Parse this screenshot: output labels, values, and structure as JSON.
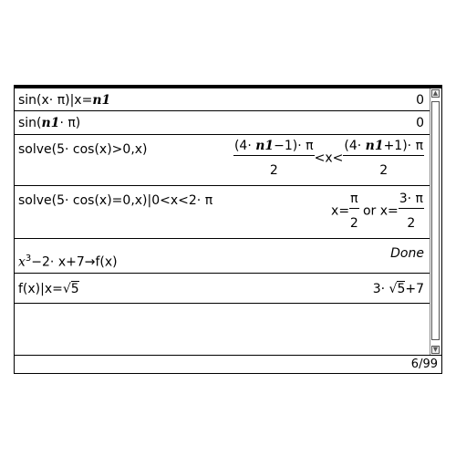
{
  "rows": [
    {
      "input_prefix": "sin(x· π)|x=",
      "input_bold": "n1",
      "output": "0"
    },
    {
      "input_prefix": "sin(",
      "input_bold": "n1",
      "input_suffix": "· π)",
      "output": "0"
    },
    {
      "input": "solve(5· cos(x)>0,x)",
      "output": {
        "left_num_pre": "(4· ",
        "left_num_bold": "n1",
        "left_num_post": "−1)· π",
        "left_den": "2",
        "middle": "<x<",
        "right_num_pre": "(4· ",
        "right_num_bold": "n1",
        "right_num_post": "+1)· π",
        "right_den": "2"
      }
    },
    {
      "input": "solve(5· cos(x)=0,x)|0<x<2· π",
      "output": {
        "lhs1": "x=",
        "frac1_num": "π",
        "frac1_den": "2",
        "or": "or",
        "lhs2": "x=",
        "frac2_num": "3· π",
        "frac2_den": "2"
      }
    },
    {
      "input_pre": "x",
      "input_exp": "3",
      "input_post": "−2· x+7→f(x)",
      "output": "Done"
    },
    {
      "input_pre": "f(x)|x=",
      "input_sqrt": "5",
      "output_pre": "3· ",
      "output_sqrt": "5",
      "output_post": "+7"
    }
  ],
  "status": {
    "page": "6/99"
  }
}
